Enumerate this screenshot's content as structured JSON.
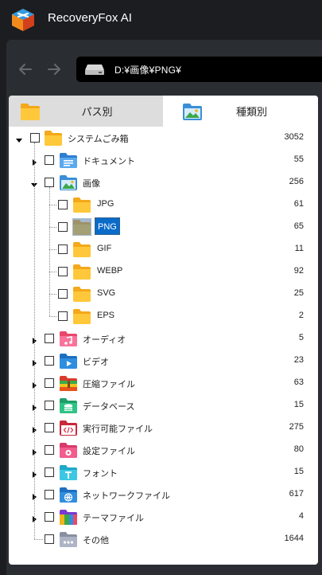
{
  "app": {
    "title": "RecoveryFox AI"
  },
  "nav": {
    "path": "D:¥画像¥PNG¥"
  },
  "tabs": [
    {
      "label": "パス別",
      "icon": "folder-icon"
    },
    {
      "label": "種類別",
      "icon": "image-folder-icon"
    }
  ],
  "tree": [
    {
      "label": "システムごみ箱",
      "count": "3052",
      "icon": "folder-icon",
      "level": 0,
      "expanded": true
    },
    {
      "label": "ドキュメント",
      "count": "55",
      "icon": "document-folder-icon",
      "level": 1,
      "expanded": false
    },
    {
      "label": "画像",
      "count": "256",
      "icon": "image-folder-icon",
      "level": 1,
      "expanded": true
    },
    {
      "label": "JPG",
      "count": "61",
      "icon": "folder-icon",
      "level": 2
    },
    {
      "label": "PNG",
      "count": "65",
      "icon": "folder-icon",
      "level": 2,
      "selected": true
    },
    {
      "label": "GIF",
      "count": "11",
      "icon": "folder-icon",
      "level": 2
    },
    {
      "label": "WEBP",
      "count": "92",
      "icon": "folder-icon",
      "level": 2
    },
    {
      "label": "SVG",
      "count": "25",
      "icon": "folder-icon",
      "level": 2
    },
    {
      "label": "EPS",
      "count": "2",
      "icon": "folder-icon",
      "level": 2
    },
    {
      "label": "オーディオ",
      "count": "5",
      "icon": "audio-folder-icon",
      "level": 1,
      "expanded": false
    },
    {
      "label": "ビデオ",
      "count": "23",
      "icon": "video-folder-icon",
      "level": 1,
      "expanded": false
    },
    {
      "label": "圧縮ファイル",
      "count": "63",
      "icon": "archive-folder-icon",
      "level": 1,
      "expanded": false
    },
    {
      "label": "データベース",
      "count": "15",
      "icon": "database-folder-icon",
      "level": 1,
      "expanded": false
    },
    {
      "label": "実行可能ファイル",
      "count": "275",
      "icon": "code-folder-icon",
      "level": 1,
      "expanded": false
    },
    {
      "label": "設定ファイル",
      "count": "80",
      "icon": "settings-folder-icon",
      "level": 1,
      "expanded": false
    },
    {
      "label": "フォント",
      "count": "15",
      "icon": "font-folder-icon",
      "level": 1,
      "expanded": false
    },
    {
      "label": "ネットワークファイル",
      "count": "617",
      "icon": "network-folder-icon",
      "level": 1,
      "expanded": false
    },
    {
      "label": "テーマファイル",
      "count": "4",
      "icon": "theme-folder-icon",
      "level": 1,
      "expanded": false
    },
    {
      "label": "その他",
      "count": "1644",
      "icon": "other-folder-icon",
      "level": 1
    }
  ],
  "colors": {
    "accent": "#0a6bc8",
    "folder": "#f7b81c",
    "chrome": "#1b1d21"
  }
}
